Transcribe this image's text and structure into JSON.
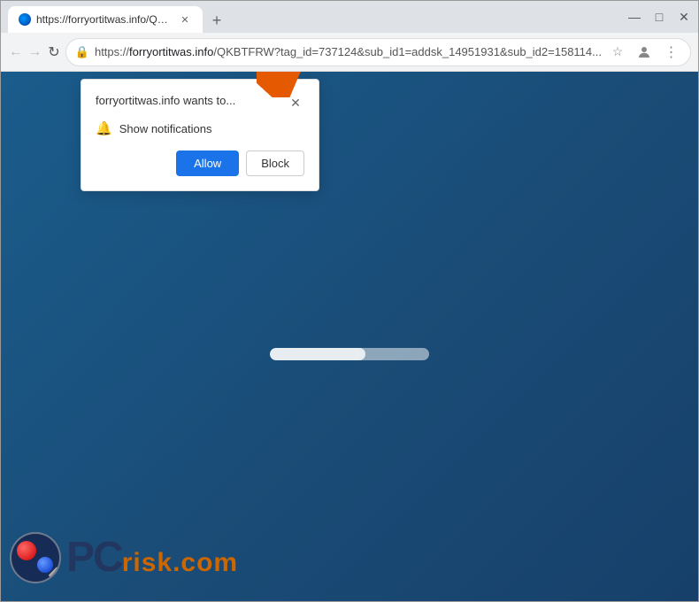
{
  "window": {
    "title": "Browser Window"
  },
  "tab": {
    "title": "https://forryortitwas.info/QKBTF...",
    "favicon_alt": "site-favicon"
  },
  "controls": {
    "minimize": "—",
    "maximize": "□",
    "close": "✕",
    "new_tab": "+"
  },
  "nav": {
    "back": "←",
    "forward": "→",
    "reload": "↻",
    "url": "https://forryortitwas.info/QKBTFRW?tag_id=737124&sub_id1=addsk_14951931&sub_id2=158114...",
    "url_site": "forryortitwas.info",
    "url_path": "/QKBTFRW?tag_id=737124&sub_id1=addsk_14951931&sub_id2=158114...",
    "lock_icon": "🔒",
    "star_icon": "☆",
    "menu_icon": "⋮"
  },
  "popup": {
    "title": "forryortitwas.info wants to...",
    "close_icon": "✕",
    "notification_text": "Show notifications",
    "allow_label": "Allow",
    "block_label": "Block"
  },
  "watermark": {
    "pc_text": "PC",
    "risk_text": "risk.com"
  }
}
